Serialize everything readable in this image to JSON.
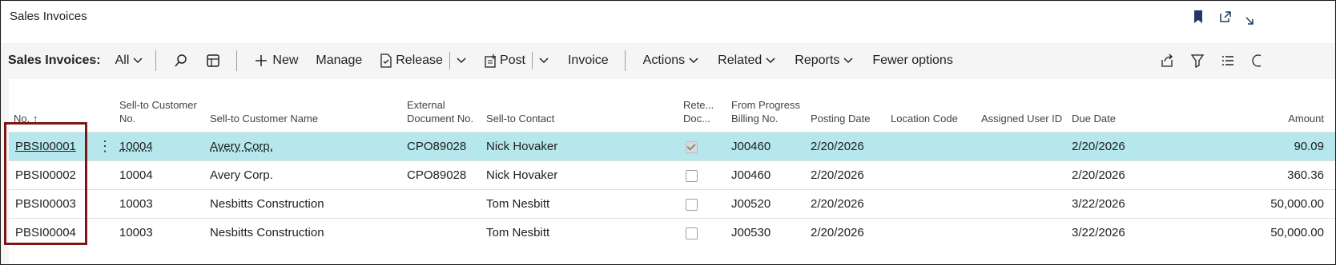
{
  "window": {
    "title": "Sales Invoices",
    "icons": [
      "bookmark-icon",
      "popout-icon",
      "collapse-icon"
    ]
  },
  "toolbar": {
    "page_label": "Sales Invoices:",
    "view_filter": "All",
    "new_label": "New",
    "manage_label": "Manage",
    "release_label": "Release",
    "post_label": "Post",
    "invoice_label": "Invoice",
    "actions_label": "Actions",
    "related_label": "Related",
    "reports_label": "Reports",
    "fewer_options_label": "Fewer options"
  },
  "grid": {
    "columns": {
      "no": "No. ↑",
      "sell_to_customer_no": "Sell-to Customer No.",
      "sell_to_customer_name": "Sell-to Customer Name",
      "external_document_no": "External Document No.",
      "sell_to_contact": "Sell-to Contact",
      "retention_doc": "Rete... Doc...",
      "from_progress_billing_no": "From Progress Billing No.",
      "posting_date": "Posting Date",
      "location_code": "Location Code",
      "assigned_user_id": "Assigned User ID",
      "due_date": "Due Date",
      "amount": "Amount"
    },
    "rows": [
      {
        "no": "PBSI00001",
        "customer_no": "10004",
        "customer_name": "Avery Corp.",
        "ext_doc": "CPO89028",
        "contact": "Nick Hovaker",
        "retention": true,
        "progress_billing": "J00460",
        "posting_date": "2/20/2026",
        "location": "",
        "assigned_user": "",
        "due_date": "2/20/2026",
        "amount": "90.09"
      },
      {
        "no": "PBSI00002",
        "customer_no": "10004",
        "customer_name": "Avery Corp.",
        "ext_doc": "CPO89028",
        "contact": "Nick Hovaker",
        "retention": false,
        "progress_billing": "J00460",
        "posting_date": "2/20/2026",
        "location": "",
        "assigned_user": "",
        "due_date": "2/20/2026",
        "amount": "360.36"
      },
      {
        "no": "PBSI00003",
        "customer_no": "10003",
        "customer_name": "Nesbitts Construction",
        "ext_doc": "",
        "contact": "Tom Nesbitt",
        "retention": false,
        "progress_billing": "J00520",
        "posting_date": "2/20/2026",
        "location": "",
        "assigned_user": "",
        "due_date": "3/22/2026",
        "amount": "50,000.00"
      },
      {
        "no": "PBSI00004",
        "customer_no": "10003",
        "customer_name": "Nesbitts Construction",
        "ext_doc": "",
        "contact": "Tom Nesbitt",
        "retention": false,
        "progress_billing": "J00530",
        "posting_date": "2/20/2026",
        "location": "",
        "assigned_user": "",
        "due_date": "3/22/2026",
        "amount": "50,000.00"
      }
    ]
  },
  "colors": {
    "selected_row": "#b5e7ec",
    "highlight_box": "#7a1616",
    "link": "#212121"
  }
}
